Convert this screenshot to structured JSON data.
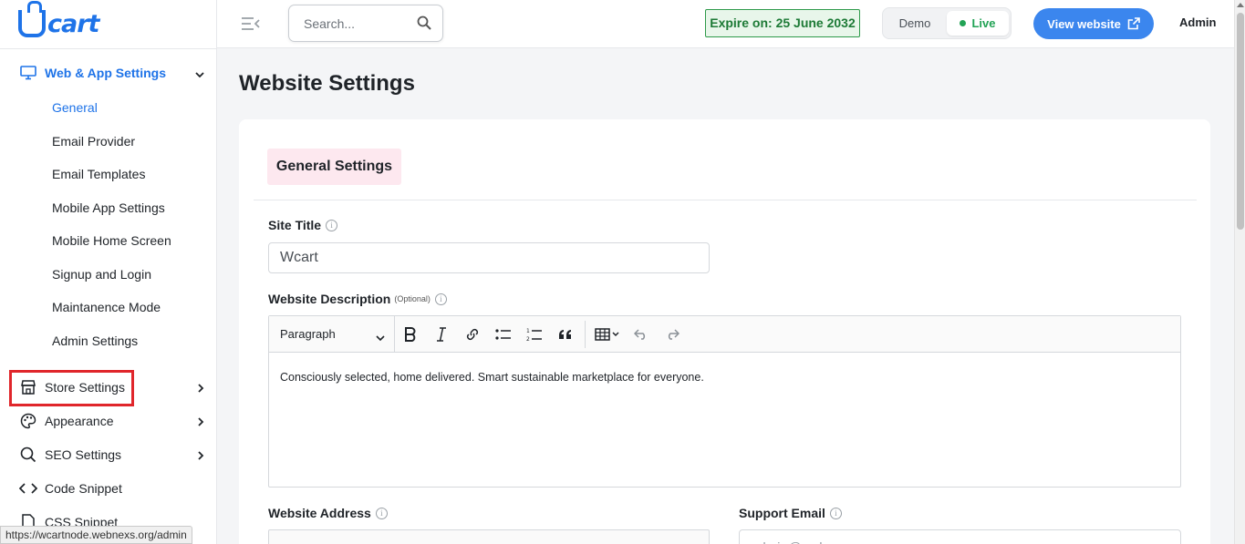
{
  "brand": {
    "logo_text": "cart"
  },
  "topbar": {
    "search_placeholder": "Search...",
    "expire_text": "Expire on: 25 June 2032",
    "mode_demo": "Demo",
    "mode_live": "Live",
    "view_website": "View website",
    "user": "Admin"
  },
  "sidebar": {
    "group_title": "Web & App Settings",
    "sub_items": [
      {
        "label": "General",
        "active": true
      },
      {
        "label": "Email Provider"
      },
      {
        "label": "Email Templates"
      },
      {
        "label": "Mobile App Settings"
      },
      {
        "label": "Mobile Home Screen"
      },
      {
        "label": "Signup and Login"
      },
      {
        "label": "Maintanence Mode"
      },
      {
        "label": "Admin Settings"
      }
    ],
    "items": [
      {
        "label": "Store Settings",
        "icon": "store-icon"
      },
      {
        "label": "Appearance",
        "icon": "palette-icon"
      },
      {
        "label": "SEO Settings",
        "icon": "search-icon"
      },
      {
        "label": "Code Snippet",
        "icon": "code-icon"
      },
      {
        "label": "CSS Snippet",
        "icon": "file-icon"
      }
    ]
  },
  "main": {
    "page_title": "Website Settings",
    "section_title": "General Settings",
    "site_title_label": "Site Title",
    "site_title_value": "Wcart",
    "description_label": "Website Description",
    "optional_text": "(Optional)",
    "editor_block_format": "Paragraph",
    "description_text": "Consciously selected, home delivered. Smart sustainable marketplace for everyone.",
    "address_label": "Website Address",
    "support_email_label": "Support Email",
    "support_email_placeholder": "admin@webnexs.com"
  },
  "status_bar_url": "https://wcartnode.webnexs.org/admin",
  "colors": {
    "accent": "#1e73e8",
    "live": "#22a355",
    "expire_border": "#2e9a4a",
    "highlight": "#e0262b",
    "chip_bg": "#fde8ef"
  }
}
